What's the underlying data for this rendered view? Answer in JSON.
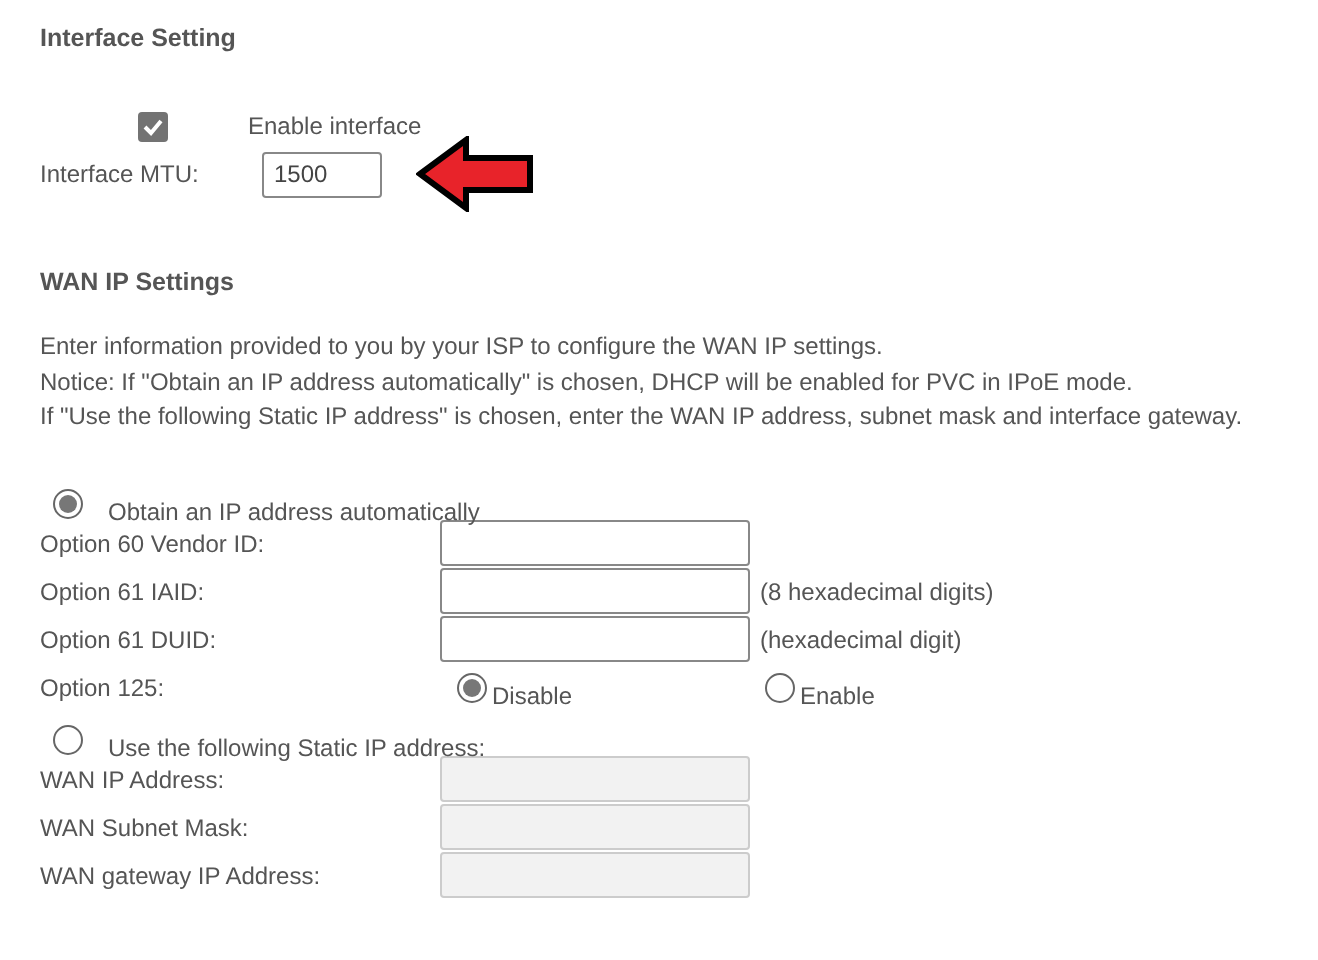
{
  "interface_setting": {
    "title": "Interface Setting",
    "enable": {
      "label": "Enable interface",
      "checked": true
    },
    "mtu": {
      "label": "Interface MTU:",
      "value": "1500"
    }
  },
  "wan_ip_settings": {
    "title": "WAN IP Settings",
    "notes": [
      "Enter information provided to you by your ISP to configure the WAN IP settings.",
      "Notice: If \"Obtain an IP address automatically\" is chosen, DHCP will be enabled for PVC in IPoE mode.",
      "If \"Use the following Static IP address\" is chosen, enter the WAN IP address, subnet mask and interface gateway."
    ],
    "modes": [
      {
        "label": "Obtain an IP address automatically",
        "selected": true,
        "fields": [
          {
            "kind": "text",
            "label": "Option 60 Vendor ID:",
            "disabled": false
          },
          {
            "kind": "text",
            "label": "Option 61 IAID:",
            "disabled": false,
            "hint": "(8 hexadecimal digits)"
          },
          {
            "kind": "text",
            "label": "Option 61 DUID:",
            "disabled": false,
            "hint": "(hexadecimal digit)"
          },
          {
            "kind": "radio",
            "label": "Option 125:",
            "options": [
              {
                "label": "Disable",
                "selected": true
              },
              {
                "label": "Enable",
                "selected": false
              }
            ]
          }
        ]
      },
      {
        "label": "Use the following Static IP address:",
        "selected": false,
        "fields": [
          {
            "kind": "text",
            "label": "WAN IP Address:",
            "disabled": true
          },
          {
            "kind": "text",
            "label": "WAN Subnet Mask:",
            "disabled": true
          },
          {
            "kind": "text",
            "label": "WAN gateway IP Address:",
            "disabled": true
          }
        ]
      }
    ]
  }
}
